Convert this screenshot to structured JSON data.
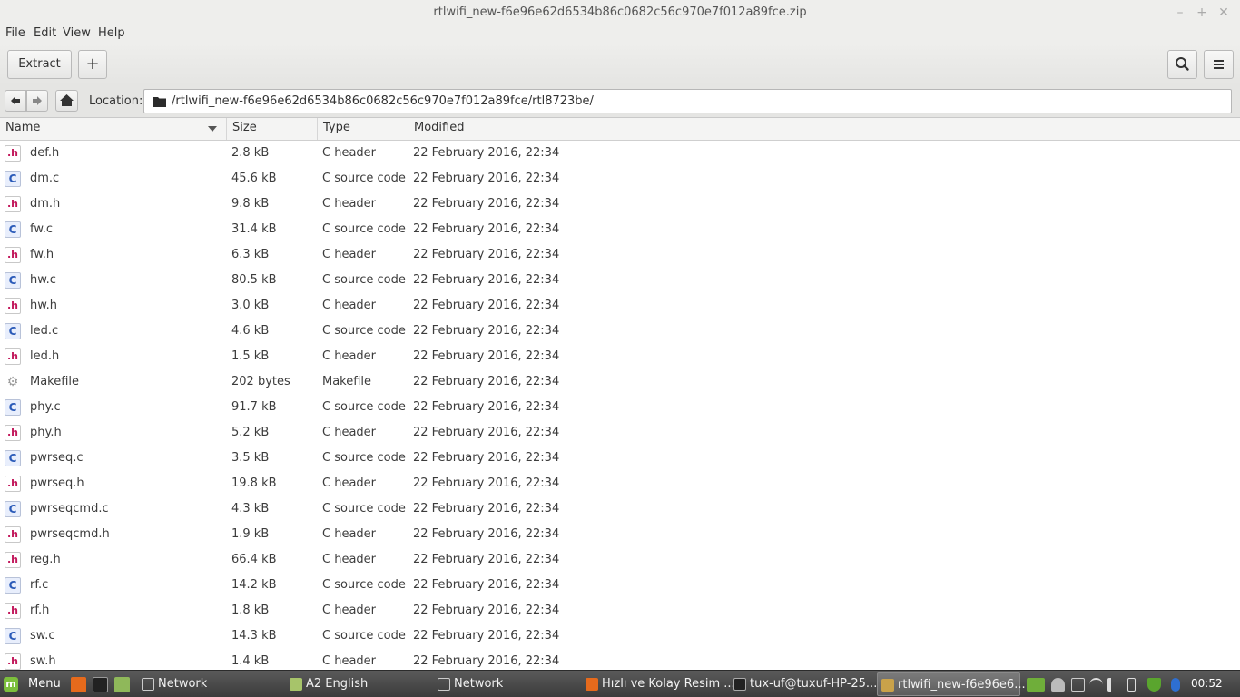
{
  "window": {
    "title": "rtlwifi_new-f6e96e62d6534b86c0682c56c970e7f012a89fce.zip",
    "minimize": "–",
    "maximize": "+",
    "close": "✕"
  },
  "menubar": {
    "items": [
      "File",
      "Edit",
      "View",
      "Help"
    ]
  },
  "toolbar": {
    "extract_label": "Extract",
    "add_label": "+"
  },
  "location": {
    "label": "Location:",
    "path": "/rtlwifi_new-f6e96e62d6534b86c0682c56c970e7f012a89fce/rtl8723be/"
  },
  "columns": [
    "Name",
    "Size",
    "Type",
    "Modified"
  ],
  "files": [
    {
      "name": "def.h",
      "size": "2.8 kB",
      "type": "C header",
      "modified": "22 February 2016, 22:34",
      "icon": "h"
    },
    {
      "name": "dm.c",
      "size": "45.6 kB",
      "type": "C source code",
      "modified": "22 February 2016, 22:34",
      "icon": "c"
    },
    {
      "name": "dm.h",
      "size": "9.8 kB",
      "type": "C header",
      "modified": "22 February 2016, 22:34",
      "icon": "h"
    },
    {
      "name": "fw.c",
      "size": "31.4 kB",
      "type": "C source code",
      "modified": "22 February 2016, 22:34",
      "icon": "c"
    },
    {
      "name": "fw.h",
      "size": "6.3 kB",
      "type": "C header",
      "modified": "22 February 2016, 22:34",
      "icon": "h"
    },
    {
      "name": "hw.c",
      "size": "80.5 kB",
      "type": "C source code",
      "modified": "22 February 2016, 22:34",
      "icon": "c"
    },
    {
      "name": "hw.h",
      "size": "3.0 kB",
      "type": "C header",
      "modified": "22 February 2016, 22:34",
      "icon": "h"
    },
    {
      "name": "led.c",
      "size": "4.6 kB",
      "type": "C source code",
      "modified": "22 February 2016, 22:34",
      "icon": "c"
    },
    {
      "name": "led.h",
      "size": "1.5 kB",
      "type": "C header",
      "modified": "22 February 2016, 22:34",
      "icon": "h"
    },
    {
      "name": "Makefile",
      "size": "202 bytes",
      "type": "Makefile",
      "modified": "22 February 2016, 22:34",
      "icon": "m"
    },
    {
      "name": "phy.c",
      "size": "91.7 kB",
      "type": "C source code",
      "modified": "22 February 2016, 22:34",
      "icon": "c"
    },
    {
      "name": "phy.h",
      "size": "5.2 kB",
      "type": "C header",
      "modified": "22 February 2016, 22:34",
      "icon": "h"
    },
    {
      "name": "pwrseq.c",
      "size": "3.5 kB",
      "type": "C source code",
      "modified": "22 February 2016, 22:34",
      "icon": "c"
    },
    {
      "name": "pwrseq.h",
      "size": "19.8 kB",
      "type": "C header",
      "modified": "22 February 2016, 22:34",
      "icon": "h"
    },
    {
      "name": "pwrseqcmd.c",
      "size": "4.3 kB",
      "type": "C source code",
      "modified": "22 February 2016, 22:34",
      "icon": "c"
    },
    {
      "name": "pwrseqcmd.h",
      "size": "1.9 kB",
      "type": "C header",
      "modified": "22 February 2016, 22:34",
      "icon": "h"
    },
    {
      "name": "reg.h",
      "size": "66.4 kB",
      "type": "C header",
      "modified": "22 February 2016, 22:34",
      "icon": "h"
    },
    {
      "name": "rf.c",
      "size": "14.2 kB",
      "type": "C source code",
      "modified": "22 February 2016, 22:34",
      "icon": "c"
    },
    {
      "name": "rf.h",
      "size": "1.8 kB",
      "type": "C header",
      "modified": "22 February 2016, 22:34",
      "icon": "h"
    },
    {
      "name": "sw.c",
      "size": "14.3 kB",
      "type": "C source code",
      "modified": "22 February 2016, 22:34",
      "icon": "c"
    },
    {
      "name": "sw.h",
      "size": "1.4 kB",
      "type": "C header",
      "modified": "22 February 2016, 22:34",
      "icon": "h"
    }
  ],
  "icons": {
    "h": ".h",
    "c": "C",
    "m": "⚙"
  },
  "taskbar": {
    "menu_label": "Menu",
    "menu_logo": "m",
    "tasks": [
      {
        "label": "Network",
        "icon": "network-icon"
      },
      {
        "label": "A2 English",
        "icon": "folder-icon"
      },
      {
        "label": "Network",
        "icon": "network-icon"
      },
      {
        "label": "Hızlı ve Kolay Resim ...",
        "icon": "firefox-icon"
      },
      {
        "label": "tux-uf@tuxuf-HP-25...",
        "icon": "terminal-icon"
      },
      {
        "label": "rtlwifi_new-f6e96e6...",
        "icon": "archive-icon"
      }
    ],
    "clock": "00:52"
  },
  "colors": {
    "accent_green": "#7cbf3c",
    "header_pink": "#c2185b",
    "source_blue": "#2a5ab8"
  }
}
